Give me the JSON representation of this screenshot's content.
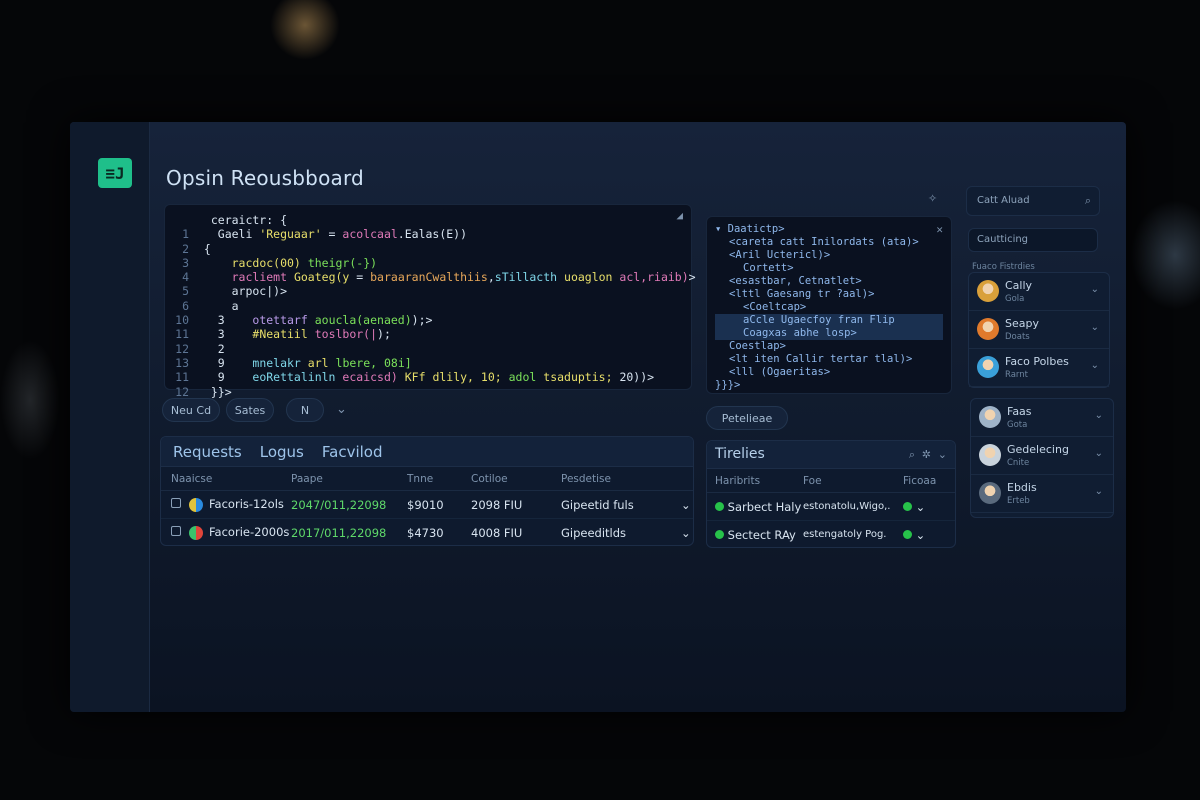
{
  "app": {
    "title": "Opsin Reousbboard",
    "logo_glyph": "≡J",
    "accent": "#1fbf8a"
  },
  "editor": {
    "lines": [
      {
        "n": "",
        "segs": [
          [
            "c-white",
            "  ceraictr: {"
          ]
        ]
      },
      {
        "n": "1",
        "segs": [
          [
            "c-white",
            "   Gaeli "
          ],
          [
            "c-yellow",
            "'Reguaar'"
          ],
          [
            "c-white",
            " = "
          ],
          [
            "c-pink",
            "acolcaal"
          ],
          [
            "c-white",
            ".Ealas(E))"
          ]
        ]
      },
      {
        "n": "2",
        "segs": [
          [
            "c-white",
            " {"
          ]
        ]
      },
      {
        "n": "3",
        "segs": [
          [
            "c-white",
            "     "
          ],
          [
            "c-yellow",
            "racdoc(00)"
          ],
          [
            "c-white",
            " "
          ],
          [
            "c-green",
            "theigr(-})"
          ]
        ]
      },
      {
        "n": "4",
        "segs": [
          [
            "c-white",
            "     "
          ],
          [
            "c-pink",
            "racliemt"
          ],
          [
            "c-white",
            " "
          ],
          [
            "c-yellow",
            "Goateg(y"
          ],
          [
            "c-white",
            " = "
          ],
          [
            "c-orange",
            "baraaranCwalthiis"
          ],
          [
            "c-white",
            ","
          ],
          [
            "c-cyan",
            "sTillacth"
          ],
          [
            "c-white",
            " "
          ],
          [
            "c-yellow",
            "uoaglon"
          ],
          [
            "c-white",
            " "
          ],
          [
            "c-pink",
            "acl,riaib)"
          ],
          [
            "c-white",
            ">"
          ]
        ]
      },
      {
        "n": "5",
        "segs": [
          [
            "c-white",
            "     arpoc|)>"
          ]
        ]
      },
      {
        "n": "6",
        "segs": [
          [
            "c-white",
            "     a"
          ]
        ]
      },
      {
        "n": "10",
        "segs": [
          [
            "c-white",
            "   3    "
          ],
          [
            "c-purple",
            "otettarf"
          ],
          [
            "c-white",
            " "
          ],
          [
            "c-green",
            "aoucla(aenaed)"
          ],
          [
            "c-white",
            ");>"
          ]
        ]
      },
      {
        "n": "11",
        "segs": [
          [
            "c-white",
            "   3    "
          ],
          [
            "c-yellow",
            "#Neatiil"
          ],
          [
            "c-white",
            " "
          ],
          [
            "c-pink",
            "toslbor(|"
          ],
          [
            "c-white",
            ");"
          ]
        ]
      },
      {
        "n": "12",
        "segs": [
          [
            "c-white",
            "   2"
          ]
        ]
      },
      {
        "n": "13",
        "segs": [
          [
            "c-white",
            "   9    "
          ],
          [
            "c-cyan",
            "mnelakr"
          ],
          [
            "c-white",
            " "
          ],
          [
            "c-yellow",
            "arl"
          ],
          [
            "c-white",
            " "
          ],
          [
            "c-green",
            "lbere, 08i]"
          ]
        ]
      },
      {
        "n": "11",
        "segs": [
          [
            "c-white",
            "   9    "
          ],
          [
            "c-cyan",
            "eoRettalinln"
          ],
          [
            "c-white",
            " "
          ],
          [
            "c-pink",
            "ecaicsd)"
          ],
          [
            "c-white",
            " "
          ],
          [
            "c-yellow",
            "KFf dlily, 10;"
          ],
          [
            "c-white",
            " "
          ],
          [
            "c-green",
            "adol"
          ],
          [
            "c-white",
            " "
          ],
          [
            "c-yellow",
            "tsaduptis;"
          ],
          [
            "c-white",
            " 20))>"
          ]
        ]
      },
      {
        "n": "12",
        "segs": [
          [
            "c-white",
            "  }}>"
          ]
        ]
      }
    ]
  },
  "tree": {
    "lines": [
      {
        "indent": 0,
        "text": "▾ Daatictp>"
      },
      {
        "indent": 1,
        "text": "<careta catt Inilordats (ata)>"
      },
      {
        "indent": 1,
        "text": "<Aril Uctericl)>"
      },
      {
        "indent": 2,
        "text": "Cortett>"
      },
      {
        "indent": 1,
        "text": "<esastbar, Cetnatlet>"
      },
      {
        "indent": 1,
        "text": "<lttl Gaesang tr ?aal)>"
      },
      {
        "indent": 2,
        "text": "<Coeltcap>"
      },
      {
        "indent": 2,
        "text": "aCcle Ugaecfoy fran Flip"
      },
      {
        "indent": 2,
        "text": "Coagxas abhe losp>"
      },
      {
        "indent": 1,
        "text": "Coestlap>"
      },
      {
        "indent": 1,
        "text": "<lt iten Callir tertar tlal)>"
      },
      {
        "indent": 1,
        "text": "<lll (Ogaeritas>"
      },
      {
        "indent": 0,
        "text": "}}}>"
      }
    ]
  },
  "toolbar": {
    "new_label": "Neu Cd",
    "save_label": "Sates",
    "extra_label": "N",
    "chevron": "⌄"
  },
  "tree_button": "Petelieae",
  "requests": {
    "tabs": [
      "Requests",
      "Logus",
      "Facvilod"
    ],
    "columns": [
      "Naaicse",
      "Paape",
      "Tnne",
      "Cotiloe",
      "Pesdetise"
    ],
    "rows": [
      {
        "name": "Facoris-12ols",
        "date": "2047/011,22098",
        "amount": "$9010",
        "time": "2098 FIU",
        "result": "Gipeetid fuls"
      },
      {
        "name": "Facorie-2000s",
        "date": "2017/011,22098",
        "amount": "$4730",
        "time": "4008 FIU",
        "result": "Gipeeditlds"
      }
    ]
  },
  "timelines": {
    "title": "Tirelies",
    "columns": [
      "Haribrits",
      "Foe",
      "Ficoaa"
    ],
    "rows": [
      {
        "name": "Sarbect Haly",
        "desc": "estonatolu,Wigo,."
      },
      {
        "name": "Sectect RAy",
        "desc": "estengatoly Pog."
      }
    ]
  },
  "sidebar": {
    "search_placeholder": "Catt Aluad",
    "filter_label": "Cautticing",
    "section_label": "Fuaco Fistrdies",
    "users_top": [
      {
        "name": "Cally",
        "sub": "Gola",
        "color": "#d9a03a"
      },
      {
        "name": "Seapy",
        "sub": "Doats",
        "color": "#e07a2c"
      },
      {
        "name": "Faco Polbes",
        "sub": "Rarnt",
        "color": "#3aa0d9"
      }
    ],
    "users_bottom": [
      {
        "name": "Faas",
        "sub": "Gota",
        "color": "#9fb3c8"
      },
      {
        "name": "Gedelecing",
        "sub": "Cnite",
        "color": "#c9d3dc"
      },
      {
        "name": "Ebdis",
        "sub": "Erteb",
        "color": "#5a6a7d"
      }
    ]
  }
}
